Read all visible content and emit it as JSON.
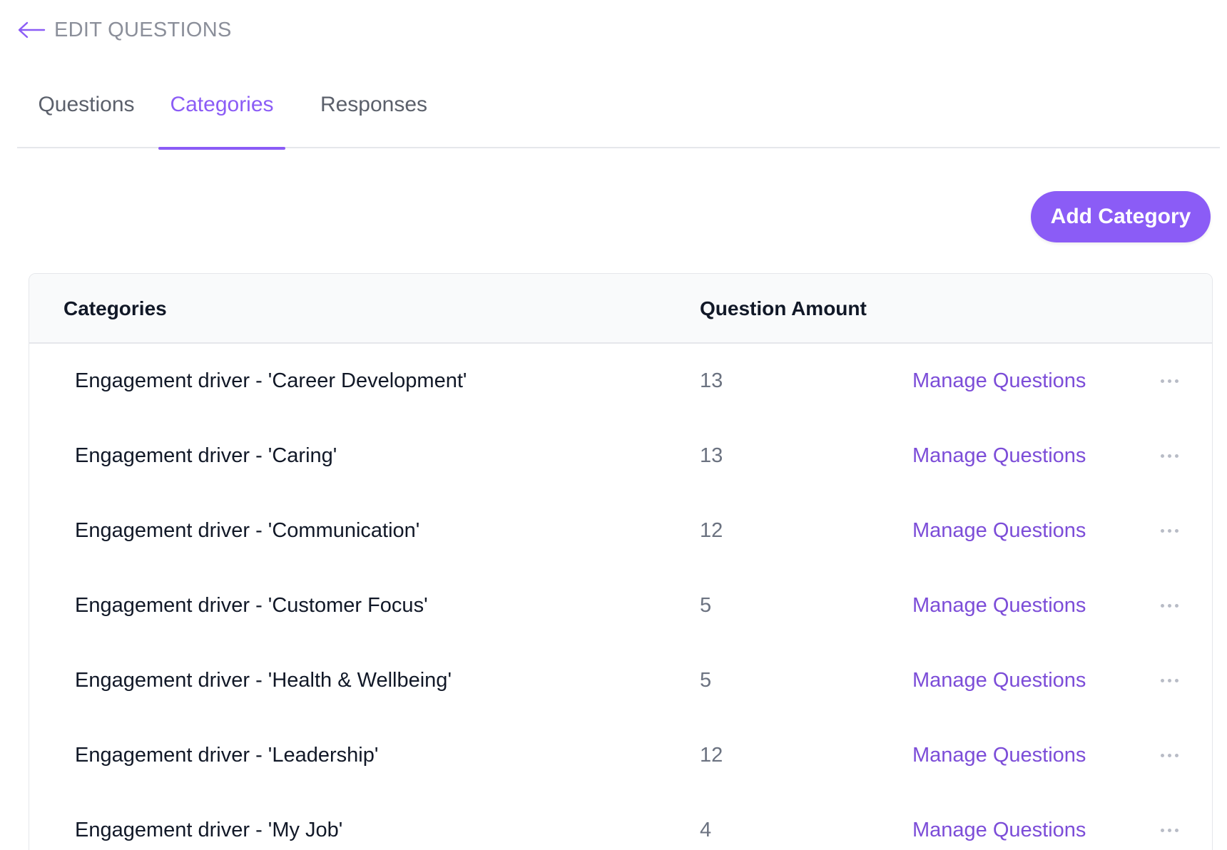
{
  "header": {
    "back_icon": "arrow-left-icon",
    "title": "EDIT QUESTIONS"
  },
  "tabs": [
    {
      "label": "Questions",
      "active": false
    },
    {
      "label": "Categories",
      "active": true
    },
    {
      "label": "Responses",
      "active": false
    }
  ],
  "actions": {
    "add_category_label": "Add Category"
  },
  "table": {
    "columns": [
      "Categories",
      "Question Amount"
    ],
    "rows": [
      {
        "name": "Engagement driver - 'Career Development'",
        "amount": "13",
        "action": "Manage Questions"
      },
      {
        "name": "Engagement driver - 'Caring'",
        "amount": "13",
        "action": "Manage Questions"
      },
      {
        "name": "Engagement driver - 'Communication'",
        "amount": "12",
        "action": "Manage Questions"
      },
      {
        "name": "Engagement driver - 'Customer Focus'",
        "amount": "5",
        "action": "Manage Questions"
      },
      {
        "name": "Engagement driver - 'Health & Wellbeing'",
        "amount": "5",
        "action": "Manage Questions"
      },
      {
        "name": "Engagement driver - 'Leadership'",
        "amount": "12",
        "action": "Manage Questions"
      },
      {
        "name": "Engagement driver - 'My Job'",
        "amount": "4",
        "action": "Manage Questions"
      }
    ]
  },
  "colors": {
    "accent": "#8b5cf6",
    "link": "#7c4dd8",
    "muted_text": "#6b7280"
  }
}
